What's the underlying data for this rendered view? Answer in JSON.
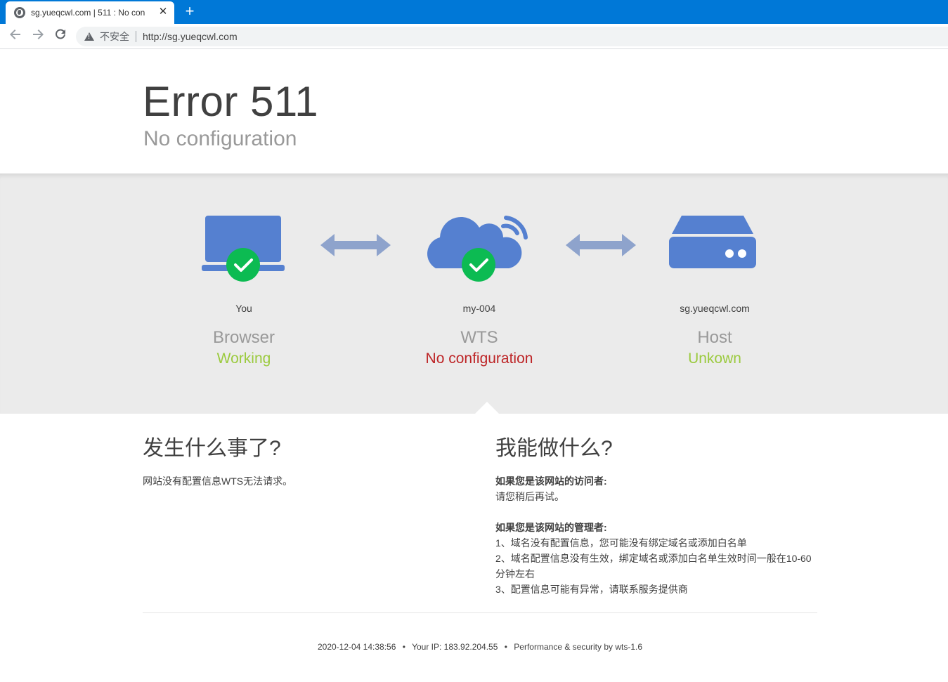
{
  "browser": {
    "tab_title": "sg.yueqcwl.com | 511 : No con",
    "close_glyph": "✕",
    "new_tab_glyph": "+",
    "security_label": "不安全",
    "url": "http://sg.yueqcwl.com"
  },
  "header": {
    "title": "Error 511",
    "subtitle": "No configuration"
  },
  "nodes": [
    {
      "name": "You",
      "label": "Browser",
      "status": "Working",
      "status_type": "ok",
      "icon": "laptop-icon"
    },
    {
      "name": "my-004",
      "label": "WTS",
      "status": "No configuration",
      "status_type": "error",
      "icon": "cloud-icon"
    },
    {
      "name": "sg.yueqcwl.com",
      "label": "Host",
      "status": "Unkown",
      "status_type": "ok",
      "icon": "server-icon"
    }
  ],
  "what_happened": {
    "heading": "发生什么事了?",
    "text": "网站没有配置信息WTS无法请求。"
  },
  "what_can_i_do": {
    "heading": "我能做什么?",
    "visitor_title": "如果您是该网站的访问者:",
    "visitor_text": "请您稍后再试。",
    "admin_title": "如果您是该网站的管理者:",
    "admin_items": [
      "1、域名没有配置信息，您可能没有绑定域名或添加白名单",
      "2、域名配置信息没有生效，绑定域名或添加白名单生效时间一般在10-60分钟左右",
      "3、配置信息可能有异常，请联系服务提供商"
    ]
  },
  "footer": {
    "timestamp": "2020-12-04 14:38:56",
    "ip": "Your IP: 183.92.204.55",
    "credit": "Performance & security by wts-1.6",
    "separator": "•"
  },
  "colors": {
    "icon_blue": "#5580d0",
    "check_green": "#0cbb52",
    "arrow": "#8ea3cc",
    "ok": "#9bca3e",
    "error": "#bd2426"
  }
}
